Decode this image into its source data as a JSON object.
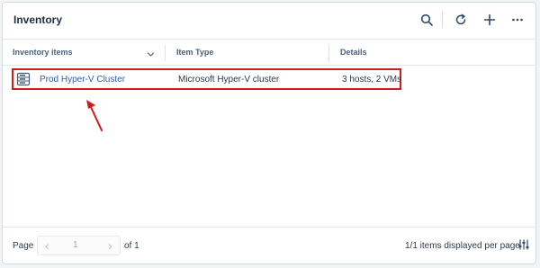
{
  "header": {
    "title": "Inventory"
  },
  "table": {
    "columns": [
      "Inventory items",
      "Item Type",
      "Details"
    ],
    "rows": [
      {
        "name": "Prod Hyper-V Cluster",
        "type": "Microsoft Hyper-V cluster",
        "details": "3 hosts, 2 VMs"
      }
    ]
  },
  "footer": {
    "page_label": "Page",
    "page_number": "1",
    "of_label": "of 1",
    "items_label": "1/1 items displayed per page"
  },
  "colors": {
    "accent": "#2a5fa8",
    "highlight": "#d11b1b"
  },
  "icons": [
    "search-icon",
    "refresh-icon",
    "add-icon",
    "more-icon",
    "sort-chevron-icon",
    "server-icon",
    "arrow-annotation",
    "chevron-left-icon",
    "chevron-right-icon",
    "column-settings-icon"
  ]
}
